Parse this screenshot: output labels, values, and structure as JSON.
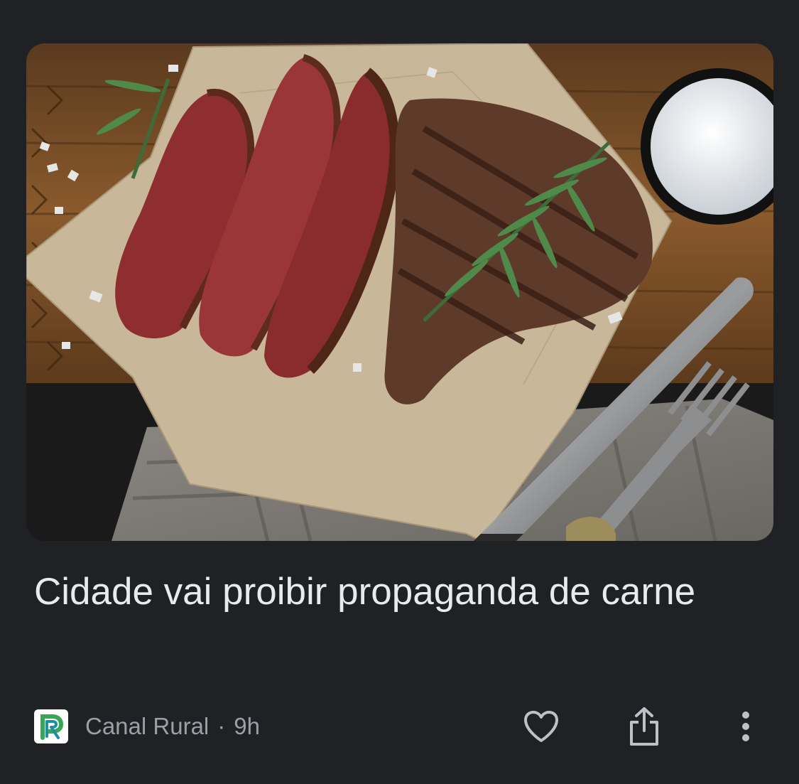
{
  "article": {
    "headline": "Cidade vai proibir propaganda de carne",
    "source_name": "Canal Rural",
    "separator": "·",
    "age": "9h"
  },
  "icons": {
    "source_logo": "canal-rural-logo-icon",
    "like": "heart-outline-icon",
    "share": "share-icon",
    "more": "more-vertical-icon"
  },
  "colors": {
    "background": "#202124",
    "headline_text": "#e8eaed",
    "meta_text": "#9aa0a6",
    "icon": "#bdc1c6",
    "logo_green": "#3aa655",
    "logo_teal": "#1c8fa0"
  }
}
